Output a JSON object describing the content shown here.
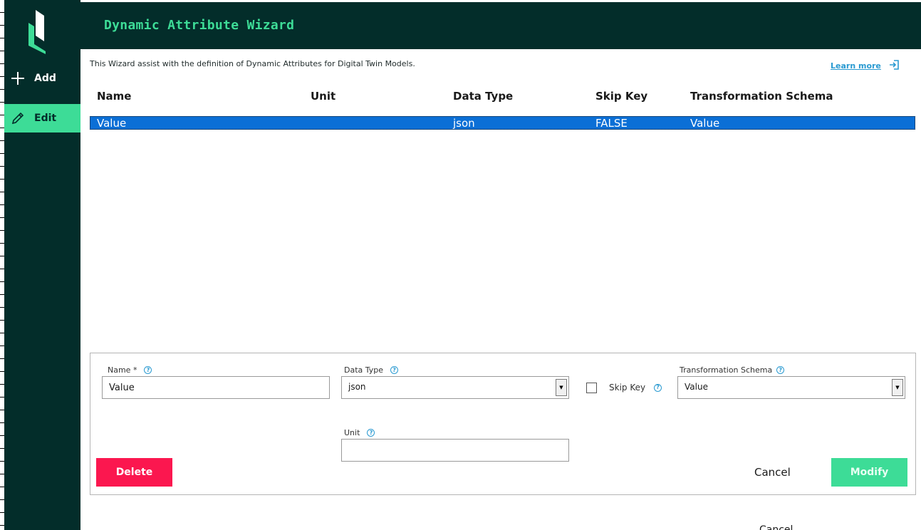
{
  "colors": {
    "sidebar_bg": "#032d2a",
    "accent_green": "#3ddc97",
    "danger_red": "#fb174f",
    "selection_blue": "#0b6fd6",
    "link_blue": "#2a9ad1"
  },
  "sidebar": {
    "items": [
      {
        "label": "Add",
        "icon": "plus-icon",
        "active": false
      },
      {
        "label": "Edit",
        "icon": "pencil-icon",
        "active": true
      }
    ]
  },
  "header": {
    "title": "Dynamic Attribute Wizard"
  },
  "intro": {
    "text": "This Wizard assist with the definition of Dynamic Attributes for Digital Twin Models.",
    "learn_more": "Learn more",
    "learn_more_icon": "external-link-icon"
  },
  "table": {
    "columns": [
      "Name",
      "Unit",
      "Data Type",
      "Skip Key",
      "Transformation Schema"
    ],
    "rows": [
      {
        "name": "Value",
        "unit": "",
        "data_type": "json",
        "skip_key": "FALSE",
        "schema": "Value",
        "selected": true
      }
    ]
  },
  "form": {
    "name_label": "Name *",
    "name_value": "Value",
    "data_type_label": "Data Type",
    "data_type_value": "json",
    "skip_key_label": "Skip Key",
    "skip_key_checked": false,
    "schema_label": "Transformation Schema",
    "schema_value": "Value",
    "unit_label": "Unit",
    "unit_value": "",
    "help_glyph": "?",
    "delete_label": "Delete",
    "cancel_label": "Cancel",
    "modify_label": "Modify"
  },
  "footer": {
    "cut_text": "Cancel"
  }
}
